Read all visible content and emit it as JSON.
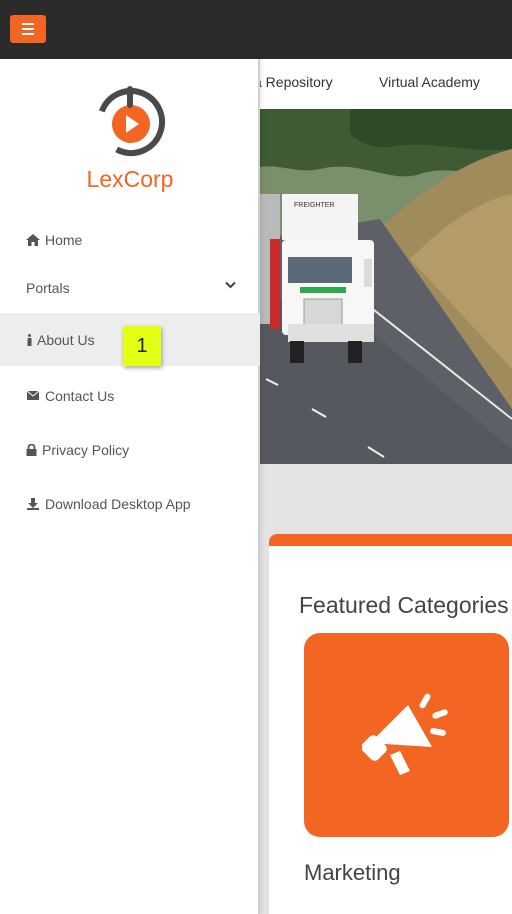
{
  "header": {
    "menu_icon": "hamburger-icon",
    "accent_color": "#f26522",
    "bar_color": "#2b2b2b"
  },
  "nav": {
    "links": [
      {
        "label": "a Repository"
      },
      {
        "label": "Virtual Academy"
      }
    ]
  },
  "sidebar": {
    "logo_text": "LexCorp",
    "items": [
      {
        "label": "Home",
        "icon": "home-icon"
      },
      {
        "label": "Portals",
        "icon": "chevron-down-icon"
      },
      {
        "label": "About Us",
        "icon": "info-icon",
        "active": true
      },
      {
        "label": "Contact Us",
        "icon": "envelope-icon"
      },
      {
        "label": "Privacy Policy",
        "icon": "lock-icon"
      },
      {
        "label": "Download Desktop App",
        "icon": "download-icon"
      }
    ]
  },
  "annotation": {
    "badge": "1",
    "badge_color": "#e3ff14"
  },
  "featured": {
    "title": "Featured Categories",
    "categories": [
      {
        "label": "Marketing",
        "icon": "megaphone-icon"
      }
    ]
  }
}
